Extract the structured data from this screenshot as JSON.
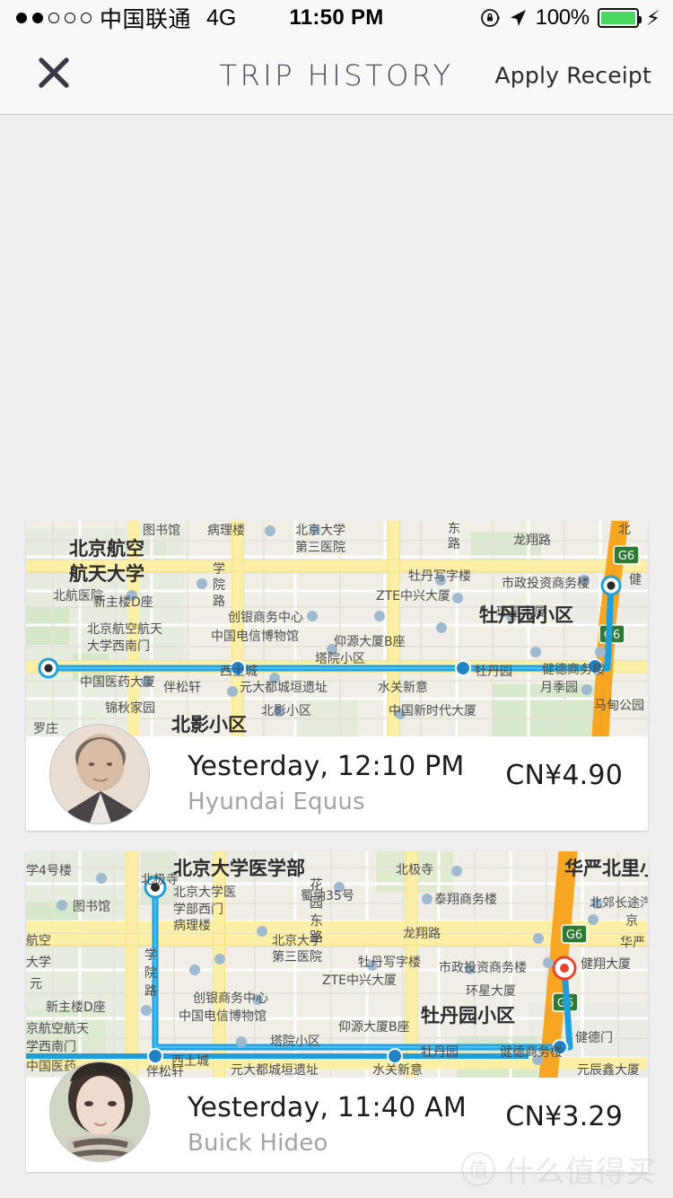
{
  "status_bar": {
    "signal_dots_filled": 2,
    "signal_dots_total": 5,
    "carrier": "中国联通",
    "network": "4G",
    "time": "11:50 PM",
    "battery_percent": "100%",
    "battery_level": 100,
    "icons": [
      "rotation-lock-icon",
      "location-arrow-icon",
      "battery-icon",
      "charging-bolt-icon"
    ],
    "colors": {
      "battery_fill": "#4cd662",
      "bar_bg": "#f8f8f8"
    }
  },
  "navbar": {
    "close_label": "close-icon",
    "title": "TRIP HISTORY",
    "action_label": "Apply Receipt",
    "colors": {
      "bg": "#f8f8f8",
      "title": "#4a4a55",
      "border": "#c4c4c6"
    }
  },
  "theme": {
    "page_bg": "#efeff0",
    "card_bg": "#ffffff",
    "route_blue": "#29a8e0",
    "highway_orange": "#f6a623",
    "road_yellow": "#fdf0a6",
    "map_bg": "#f2efe9",
    "park_green": "#d5e7c8"
  },
  "trips": [
    {
      "avatar": "driver-photo-1",
      "when": "Yesterday, 12:10 PM",
      "car": "Hyundai Equus",
      "fare": "CN¥4.90",
      "map": {
        "labels_large": [
          "北京航空",
          "航天大学",
          "牡丹园小区"
        ],
        "labels": [
          "图书馆",
          "病理楼",
          "北京大学",
          "第三医院",
          "东",
          "路",
          "龙翔路",
          "北航医院",
          "学院",
          "路",
          "牡丹写字楼",
          "市政投资商务楼",
          "健",
          "新主楼D座",
          "ZTE中兴大厦",
          "环星大厦",
          "北京航空航天",
          "大学西南门",
          "创银商务中心",
          "中国电信博物馆",
          "仰源大厦B座",
          "塔院小区",
          "中国医药大厦",
          "西土城",
          "牡丹园",
          "健德商务楼",
          "锦秋家园",
          "伴松轩",
          "元大都城垣遗址",
          "水关新意",
          "月季园",
          "北影小区",
          "中国新时代大厦",
          "马甸公园",
          "罗庄",
          "G6"
        ]
      }
    },
    {
      "avatar": "driver-photo-2",
      "when": "Yesterday, 11:40 AM",
      "car": "Buick Hideo",
      "fare": "CN¥3.29",
      "map": {
        "labels_large": [
          "北京大学医学部",
          "华严北里小区",
          "牡丹园小区"
        ],
        "labels": [
          "学4号楼",
          "图书馆",
          "北京大学医",
          "学部西门",
          "病理楼",
          "蜀纳35号",
          "北极寺",
          "花园",
          "东路",
          "泰翔商务楼",
          "龙翔路",
          "G6",
          "北郊长途汽车站",
          "京",
          "航空",
          "大学",
          "北京大学",
          "第三医院",
          "华严",
          "新主楼D座",
          "学院路",
          "牡丹写字楼",
          "ZTE中兴大厦",
          "市政投资商务楼",
          "健翔大厦",
          "京航空航天",
          "学西南门",
          "创银商务中心",
          "中国电信博物馆",
          "环星大厦",
          "仰源大厦B座",
          "塔院小区",
          "健德门",
          "牡丹园",
          "健德商务楼",
          "中国医药",
          "西土城",
          "伴松轩",
          "元大都城垣遗址",
          "水关新意",
          "元辰鑫大厦"
        ]
      }
    }
  ],
  "watermark": {
    "badge": "值",
    "text": "什么值得买"
  }
}
